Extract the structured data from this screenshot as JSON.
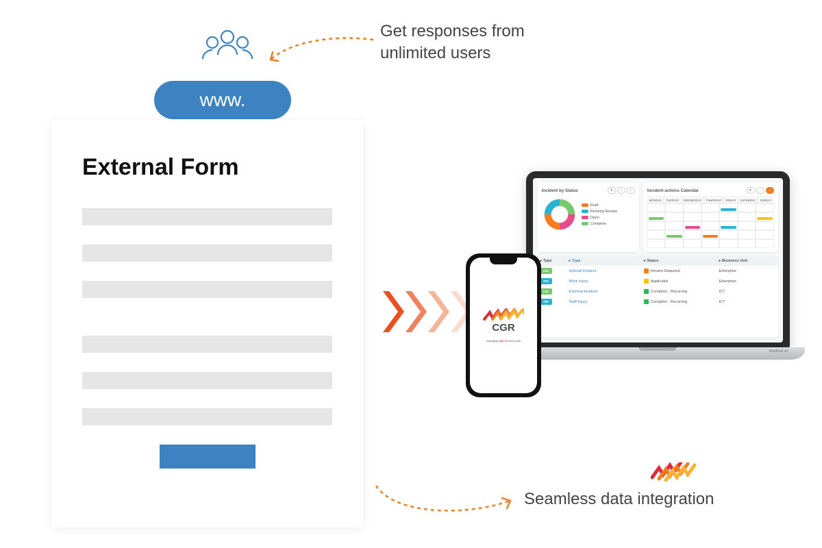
{
  "annotations": {
    "topLine1": "Get responses from",
    "topLine2": "unlimited users",
    "bottom": "Seamless data integration"
  },
  "wwwLabel": "www.",
  "form": {
    "title": "External Form"
  },
  "brand": {
    "name": "CGR",
    "tagline_before": "managing ",
    "tagline_bold": "risk",
    "tagline_after": " at every level",
    "colors": {
      "red": "#da2c3b",
      "orange": "#f57c1f",
      "amber": "#f9b233"
    }
  },
  "laptop": {
    "brand": "MacBook Air"
  },
  "dashboard": {
    "cardStatus": {
      "title": "Incident by Status",
      "legend": [
        {
          "label": "Draft",
          "color": "#f57c1f"
        },
        {
          "label": "Pending Review",
          "color": "#2bb3d5"
        },
        {
          "label": "Open",
          "color": "#e94a8a"
        },
        {
          "label": "Complete",
          "color": "#78c96d"
        }
      ]
    },
    "cardCalendar": {
      "title": "Incident actions Calendar",
      "days": [
        "MONDAY",
        "TUESDAY",
        "WEDNESDAY",
        "THURSDAY",
        "FRIDAY",
        "SATURDAY",
        "SUNDAY"
      ]
    },
    "table": {
      "headers": {
        "type": "Type",
        "typeLong": "Type",
        "status": "Status",
        "bu": "Business Unit"
      },
      "rows": [
        {
          "badge": "IAG",
          "badgeColor": "#78c96d",
          "typeLong": "Internal Incident",
          "status": "Review Required",
          "statusColor": "#f57c1f",
          "bu": "Enterprise"
        },
        {
          "badge": "FIN",
          "badgeColor": "#2bb3d5",
          "typeLong": "Work Injury",
          "status": "Applicable",
          "statusColor": "#f9c600",
          "bu": "Enterprise"
        },
        {
          "badge": "IAG",
          "badgeColor": "#78c96d",
          "typeLong": "External Incident",
          "status": "Complete - Recurring",
          "statusColor": "#2fb757",
          "bu": "ICT"
        },
        {
          "badge": "FIN",
          "badgeColor": "#2bb3d5",
          "typeLong": "Staff Injury",
          "status": "Complete - Recurring",
          "statusColor": "#2fb757",
          "bu": "ICT"
        }
      ]
    }
  },
  "chart_data": {
    "type": "pie",
    "title": "Incident by Status",
    "categories": [
      "Draft",
      "Pending Review",
      "Open",
      "Complete"
    ],
    "values": [
      25,
      25,
      25,
      25
    ],
    "colors": [
      "#f57c1f",
      "#2bb3d5",
      "#e94a8a",
      "#78c96d"
    ]
  }
}
